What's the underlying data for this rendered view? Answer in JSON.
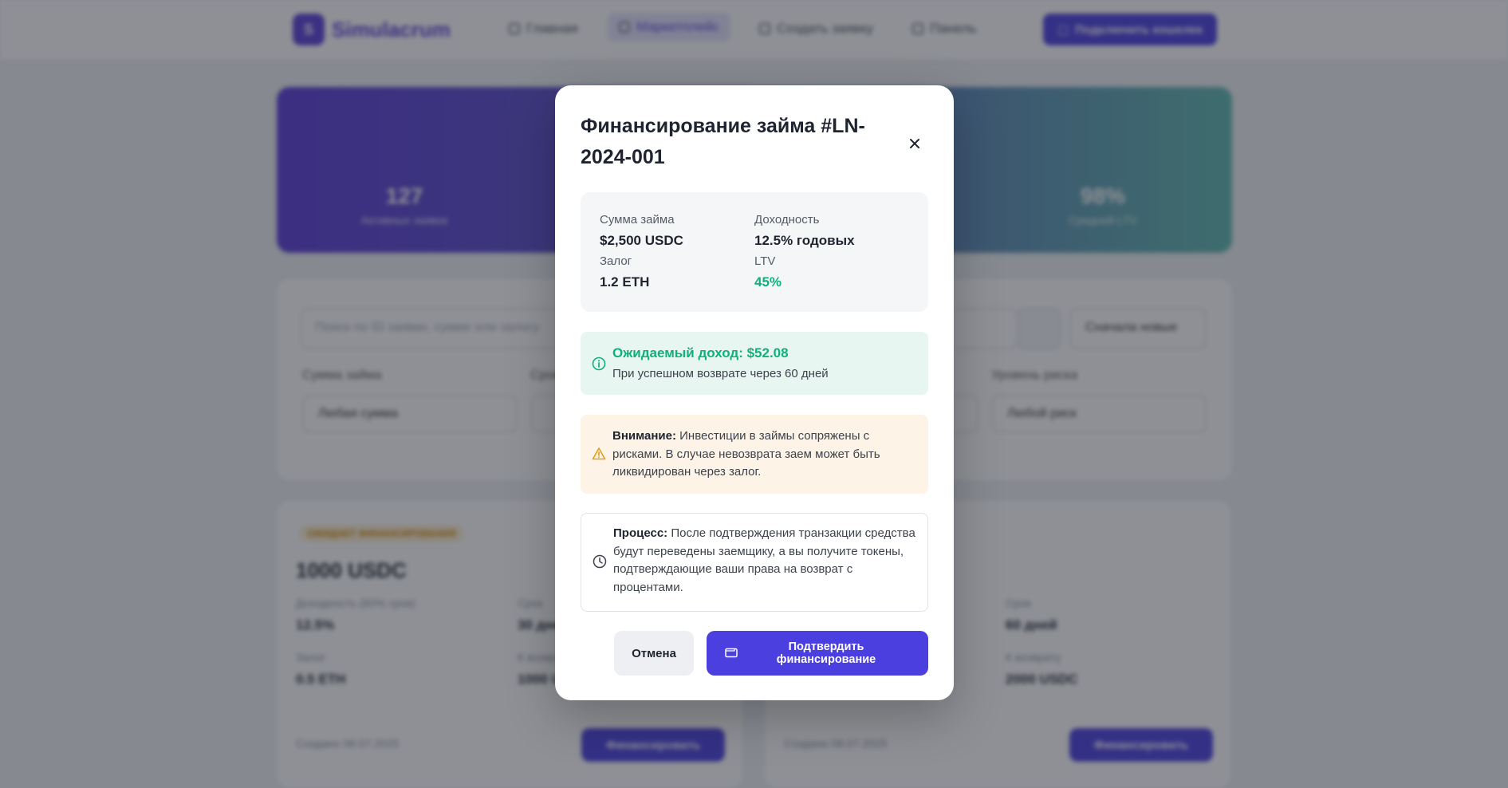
{
  "nav": {
    "logo_letter": "S",
    "brand": "Simulacrum",
    "items": [
      {
        "label": "Главная",
        "icon": "home-icon"
      },
      {
        "label": "Маркетплейс",
        "icon": "grid-icon"
      },
      {
        "label": "Создать заявку",
        "icon": "plus-circle-icon"
      },
      {
        "label": "Панель",
        "icon": "dashboard-icon"
      }
    ],
    "connect_label": "Подключить кошелек"
  },
  "stats": [
    {
      "value": "127",
      "label": "Активных заявок"
    },
    {
      "value": "98%",
      "label": "Средний LTV"
    }
  ],
  "filters": {
    "search_placeholder": "Поиск по ID заявки, сумме или залогу",
    "sort_value": "Сначала новые",
    "amount_label": "Сумма займа",
    "amount_value": "Любая сумма",
    "term_label": "Срок",
    "risk_label": "Уровень риска",
    "risk_value": "Любой риск"
  },
  "cards": [
    {
      "badge": "ОЖИДАЕТ ФИНАНСИРОВАНИЯ",
      "amount": "1000 USDC",
      "yield_label": "Доходность (60% срок)",
      "yield_value": "12.5%",
      "term_label": "Срок",
      "term_value": "30 дней",
      "collateral_label": "Залог",
      "collateral_value": "0.5 ETH",
      "return_label": "К возврату",
      "return_value": "1000 USDC",
      "created": "Создано 08.07.2025",
      "fund_label": "Финансировать"
    },
    {
      "term_label": "Срок",
      "term_value": "60 дней",
      "return_label": "К возврату",
      "return_value": "2000 USDC",
      "created": "Создано 08.07.2025",
      "fund_label": "Финансировать"
    }
  ],
  "modal": {
    "title": "Финансирование займа #LN-2024-001",
    "summary": {
      "amount_label": "Сумма займа",
      "amount_value": "$2,500 USDC",
      "yield_label": "Доходность",
      "yield_value": "12.5% годовых",
      "collateral_label": "Залог",
      "collateral_value": "1.2 ETH",
      "ltv_label": "LTV",
      "ltv_value": "45%"
    },
    "income": {
      "title": "Ожидаемый доход: $52.08",
      "subtitle": "При успешном возврате через 60 дней"
    },
    "warning": {
      "lead": "Внимание:",
      "text": " Инвестиции в займы сопряжены с рисками. В случае невозврата заем может быть ликвидирован через залог."
    },
    "process": {
      "lead": "Процесс:",
      "text": " После подтверждения транзакции средства будут переведены заемщику, а вы получите токены, подтверждающие ваши права на возврат с процентами."
    },
    "cancel_label": "Отмена",
    "confirm_label": "Подтвердить финансирование",
    "colors": {
      "accent": "#4b3fe0",
      "success": "#10b07a",
      "warning": "#e0a020"
    }
  }
}
